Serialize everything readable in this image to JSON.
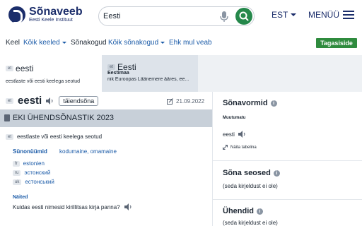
{
  "header": {
    "logo_title": "Sõnaveeb",
    "logo_sub": "Eesti Keele Instituut",
    "search_value": "Eesti",
    "lang": "EST",
    "menu": "MENÜÜ"
  },
  "filters": {
    "keel_label": "Keel",
    "keel_value": "Kõik keeled",
    "sonakogud_label": "Sõnakogud",
    "sonakogud_value": "Kõik sõnakogud",
    "error_link": "Ehk mul veab",
    "feedback": "Tagasiside"
  },
  "results": [
    {
      "tag": "et",
      "word": "eesti",
      "desc1": "",
      "desc2": "eestlaste või eesti keelega seotud"
    },
    {
      "tag": "et",
      "word": "Eesti",
      "desc1": "Eestimaa",
      "desc2": "riik Euroopas Läänemere ääres, ee..."
    }
  ],
  "main": {
    "tag": "et",
    "word": "eesti",
    "pos": "täiendsõna",
    "date": "21.09.2022",
    "dict_title": "EKI ÜHENDSÕNASTIK 2023",
    "sense_tag": "et",
    "sense": "eestlaste või eesti keelega seotud",
    "syn_label": "Sünonüümid",
    "syn_links": "kodumaine, omamaine",
    "translations": [
      {
        "tag": "fr",
        "word": "estonien"
      },
      {
        "tag": "ru",
        "word": "эстонский"
      },
      {
        "tag": "uk",
        "word": "естонський"
      }
    ],
    "examples_label": "Näited",
    "example": "Kuidas eesti nimesid kirillitsas kirja panna?"
  },
  "side": {
    "forms_title": "Sõnavormid",
    "forms_sub": "Muutumatu",
    "forms_value": "eesti",
    "forms_link": "Näita tabelina",
    "relations_title": "Sõna seosed",
    "relations_note": "(seda kirjeldust ei ole)",
    "compounds_title": "Ühendid",
    "compounds_note": "(seda kirjeldust ei ole)"
  },
  "colors": {
    "brand": "#1c2e6b",
    "link": "#1b5ba8",
    "green": "#25884b"
  }
}
